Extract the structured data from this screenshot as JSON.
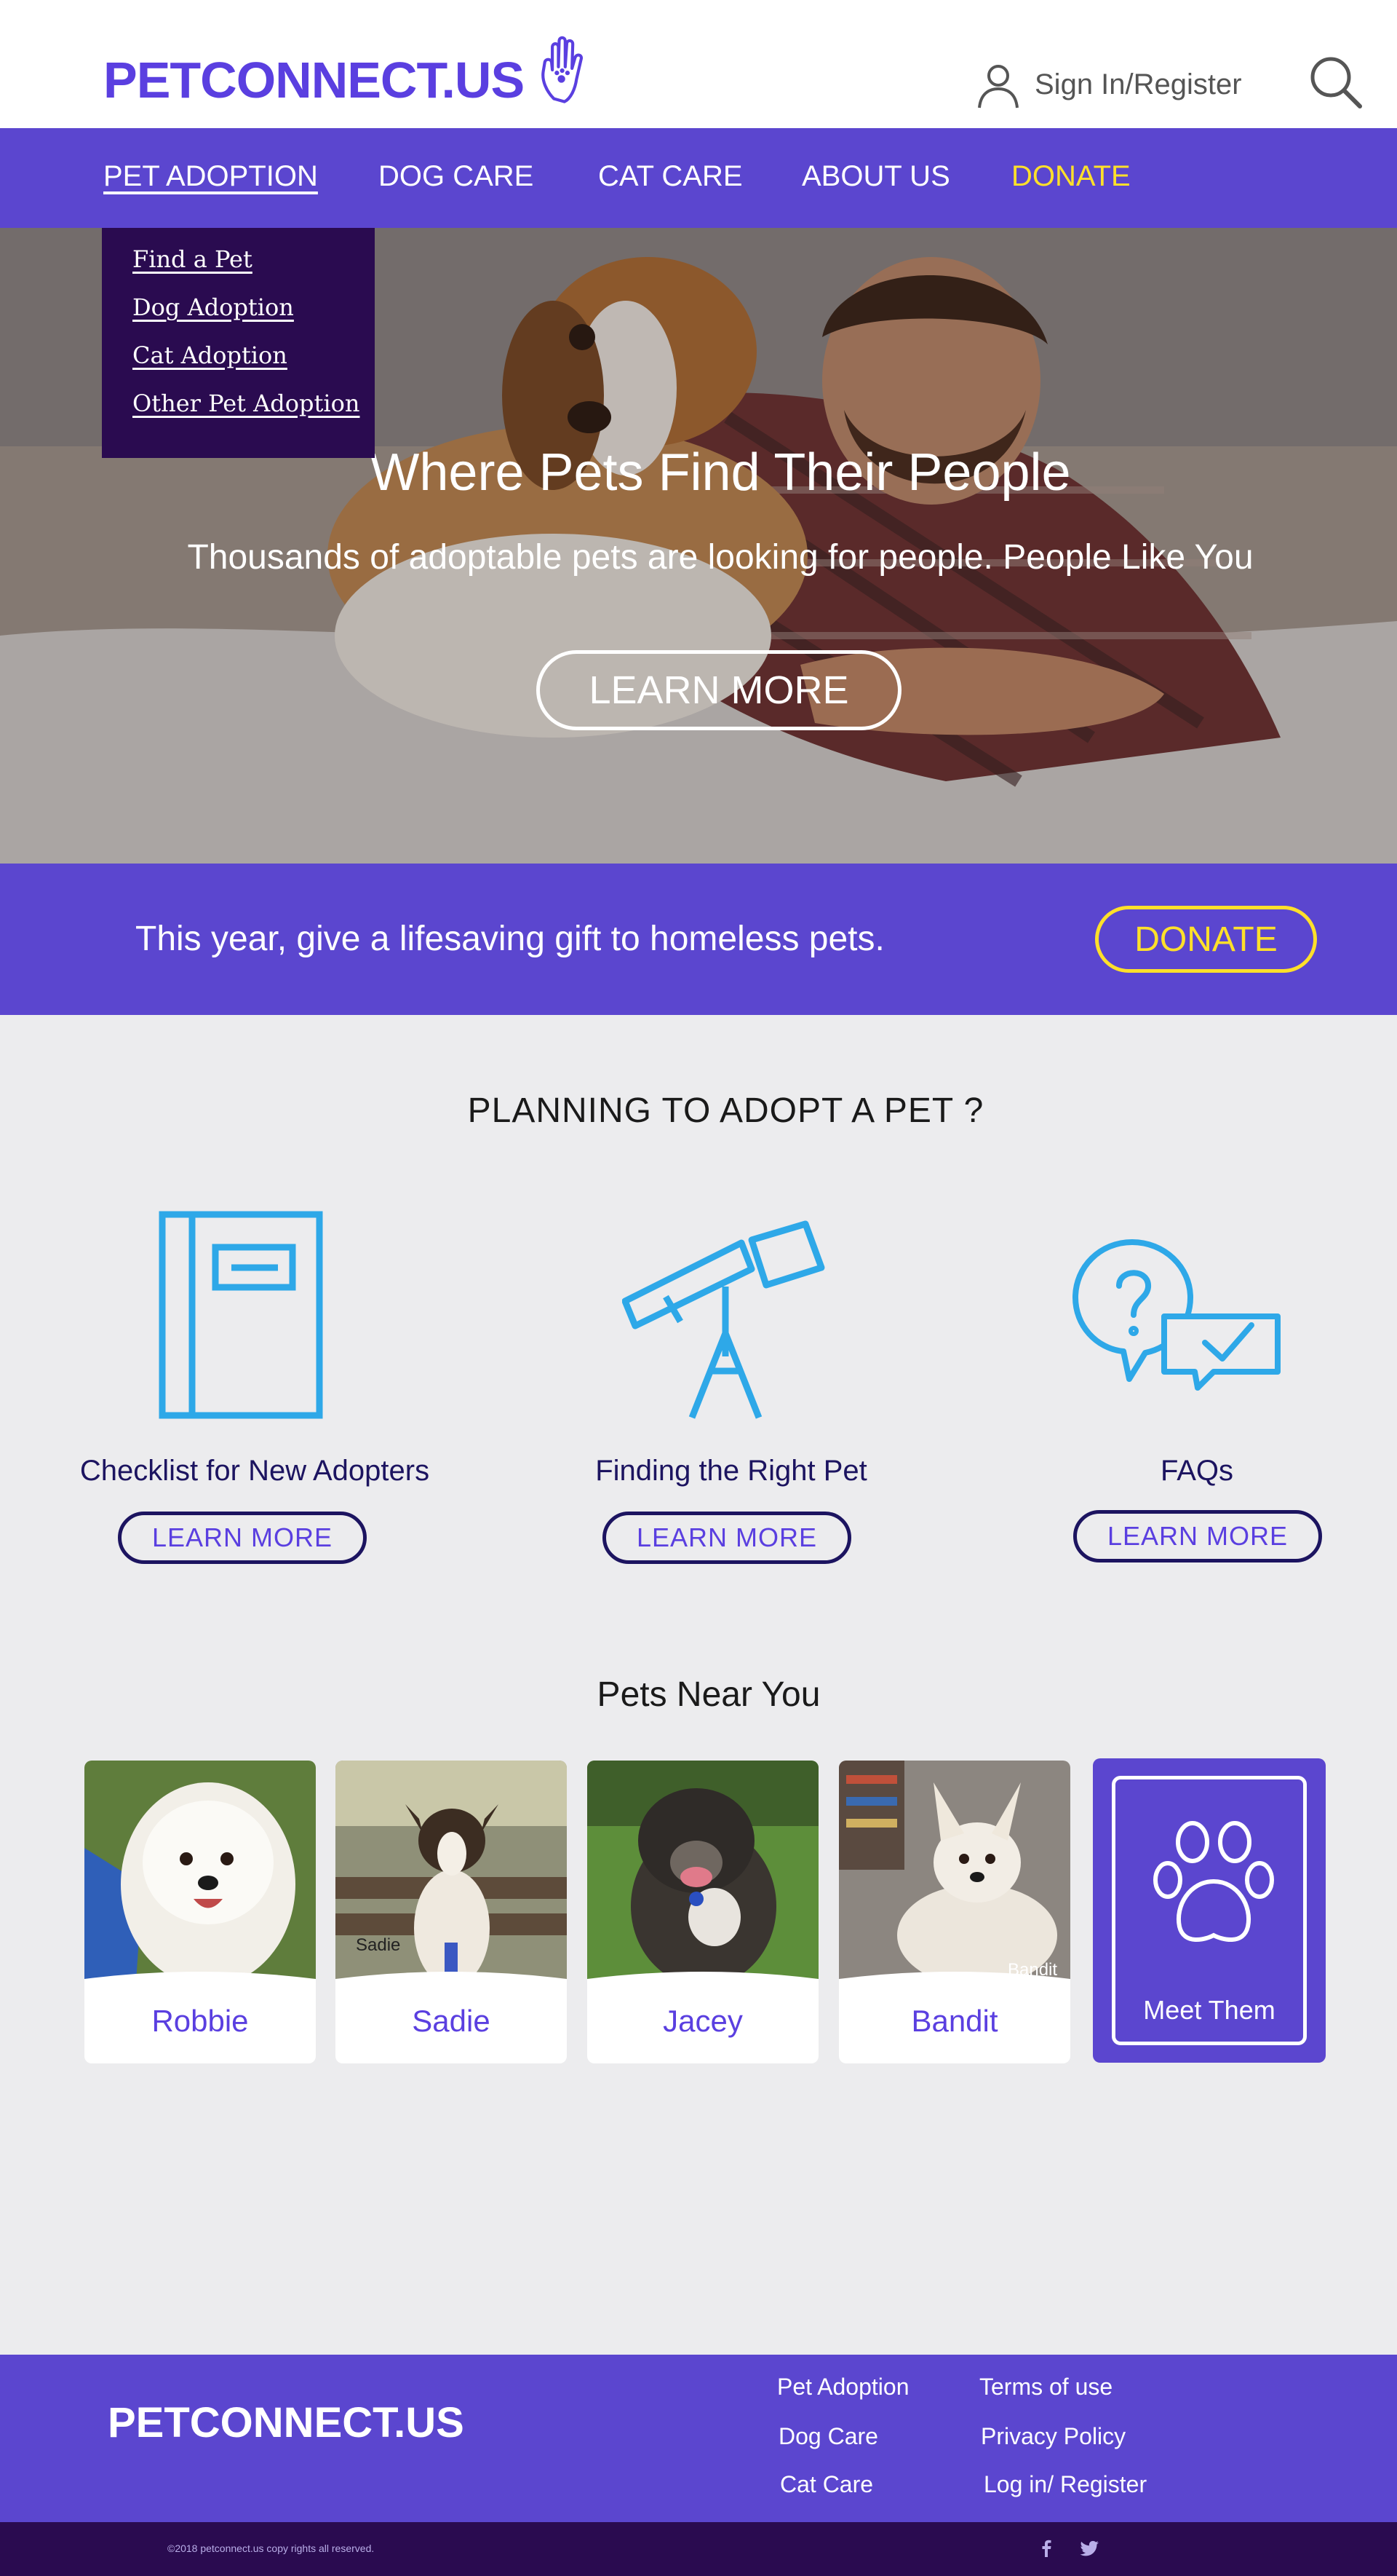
{
  "header": {
    "logo": "PETCONNECT.US",
    "signin_label": "Sign In/Register"
  },
  "nav": {
    "items": [
      {
        "label": "PET ADOPTION",
        "active": true
      },
      {
        "label": "DOG CARE"
      },
      {
        "label": "CAT CARE"
      },
      {
        "label": "ABOUT US"
      },
      {
        "label": "DONATE",
        "highlight": true
      }
    ]
  },
  "dropdown": {
    "items": [
      "Find a Pet",
      "Dog Adoption",
      "Cat Adoption",
      "Other Pet Adoption"
    ]
  },
  "hero": {
    "title": "Where Pets Find Their People",
    "subtitle": "Thousands of adoptable pets are looking for people. People Like You",
    "button": "LEARN MORE"
  },
  "banner": {
    "text": "This year, give a lifesaving gift to homeless pets.",
    "button": "DONATE"
  },
  "planning": {
    "title": "PLANNING TO ADOPT A PET ?",
    "items": [
      {
        "icon": "book-icon",
        "label": "Checklist for New Adopters",
        "button": "LEARN MORE"
      },
      {
        "icon": "telescope-icon",
        "label": "Finding the Right Pet",
        "button": "LEARN MORE"
      },
      {
        "icon": "faq-chat-icon",
        "label": "FAQs",
        "button": "LEARN MORE"
      }
    ]
  },
  "pets": {
    "title": "Pets Near You",
    "items": [
      {
        "name": "Robbie"
      },
      {
        "name": "Sadie",
        "caption": "Sadie"
      },
      {
        "name": "Jacey"
      },
      {
        "name": "Bandit",
        "caption": "Bandit"
      }
    ],
    "meet": "Meet Them"
  },
  "footer": {
    "logo": "PETCONNECT.US",
    "links_col1": [
      "Pet Adoption",
      "Dog Care",
      "Cat Care"
    ],
    "links_col2": [
      "Terms of use",
      "Privacy Policy",
      "Log in/ Register"
    ],
    "copyright": "©2018  petconnect.us copy rights all reserved."
  },
  "colors": {
    "brand_purple": "#5b46cf",
    "dark_purple": "#2a0b50",
    "accent_yellow": "#ffe02a",
    "icon_blue": "#2ea8e8"
  }
}
